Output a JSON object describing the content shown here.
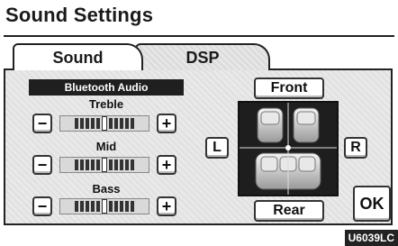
{
  "window": {
    "title": "Sound Settings"
  },
  "tabs": [
    {
      "label": "Sound",
      "active": true
    },
    {
      "label": "DSP",
      "active": false
    }
  ],
  "source": {
    "label": "Bluetooth Audio"
  },
  "sliders": [
    {
      "label": "Treble",
      "minus": "−",
      "plus": "+",
      "level": 0
    },
    {
      "label": "Mid",
      "minus": "−",
      "plus": "+",
      "level": 0
    },
    {
      "label": "Bass",
      "minus": "−",
      "plus": "+",
      "level": 0
    }
  ],
  "balance": {
    "front": "Front",
    "rear": "Rear",
    "left": "L",
    "right": "R"
  },
  "ok_label": "OK",
  "figure_code": "U6039LC",
  "colors": {
    "panel": "#e9e9e9",
    "dark": "#1f1f1f",
    "text": "#111111"
  }
}
